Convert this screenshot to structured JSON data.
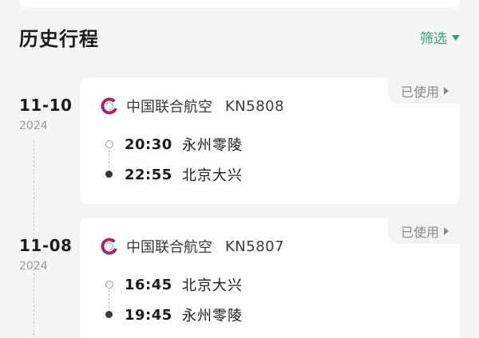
{
  "header": {
    "title": "历史行程",
    "filter_label": "筛选"
  },
  "trips": [
    {
      "date": "11-10",
      "year": "2024",
      "status": "已使用",
      "airline": "中国联合航空",
      "flight_no": "KN5808",
      "departure": {
        "time": "20:30",
        "city": "永州零陵"
      },
      "arrival": {
        "time": "22:55",
        "city": "北京大兴"
      }
    },
    {
      "date": "11-08",
      "year": "2024",
      "status": "已使用",
      "airline": "中国联合航空",
      "flight_no": "KN5807",
      "departure": {
        "time": "16:45",
        "city": "北京大兴"
      },
      "arrival": {
        "time": "19:45",
        "city": "永州零陵"
      }
    }
  ],
  "icons": {
    "airline_logo": "china-united-airlines-logo",
    "filter_caret": "caret-down-icon",
    "status_arrow": "caret-right-icon"
  },
  "colors": {
    "accent_green": "#2aa86a",
    "logo_magenta": "#a02a6a",
    "background": "#f4f5f7"
  }
}
